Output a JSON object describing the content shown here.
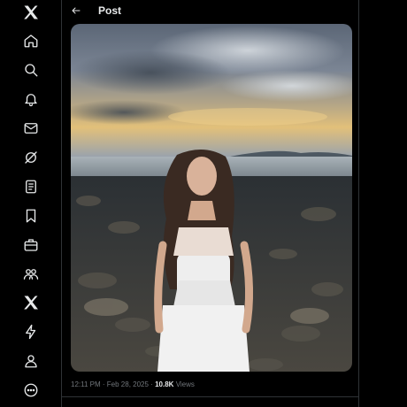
{
  "sidebar": {
    "items": [
      {
        "icon": "x-logo-icon",
        "label": "X"
      },
      {
        "icon": "home-icon",
        "label": "Home"
      },
      {
        "icon": "search-icon",
        "label": "Explore"
      },
      {
        "icon": "bell-icon",
        "label": "Notifications"
      },
      {
        "icon": "mail-icon",
        "label": "Messages"
      },
      {
        "icon": "grok-icon",
        "label": "Grok"
      },
      {
        "icon": "lists-icon",
        "label": "Lists"
      },
      {
        "icon": "bookmark-icon",
        "label": "Bookmarks"
      },
      {
        "icon": "briefcase-icon",
        "label": "Jobs"
      },
      {
        "icon": "communities-icon",
        "label": "Communities"
      },
      {
        "icon": "premium-icon",
        "label": "Premium"
      },
      {
        "icon": "lightning-icon",
        "label": "Verified Orgs"
      },
      {
        "icon": "profile-icon",
        "label": "Profile"
      },
      {
        "icon": "more-icon",
        "label": "More"
      }
    ]
  },
  "header": {
    "title": "Post",
    "back_icon": "back-arrow-icon"
  },
  "post": {
    "time": "12:11 PM",
    "separator": "·",
    "date": "Feb 28, 2025",
    "views_count": "10.8K",
    "views_label": "Views"
  },
  "colors": {
    "background": "#000000",
    "text": "#e7e9ea",
    "muted": "#71767b",
    "border": "#2f3336"
  }
}
